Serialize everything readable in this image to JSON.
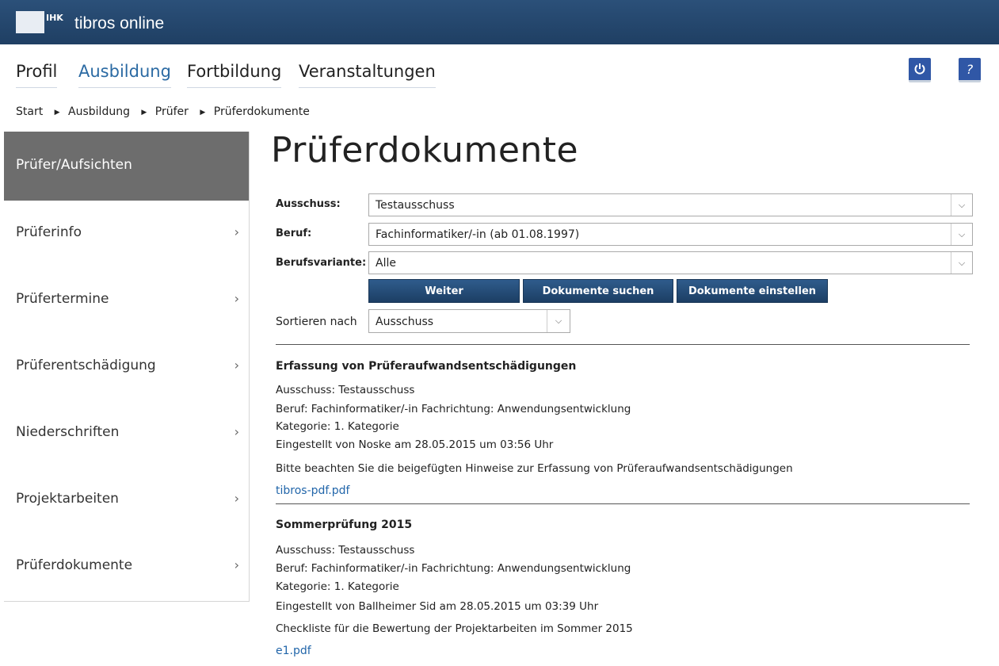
{
  "header": {
    "logo_text": "IHK",
    "app_title": "tibros online"
  },
  "mainnav": {
    "items": [
      {
        "label": "Profil"
      },
      {
        "label": "Ausbildung",
        "active": true
      },
      {
        "label": "Fortbildung"
      },
      {
        "label": "Veranstaltungen"
      }
    ],
    "logout_icon": "power-icon",
    "help_label": "?"
  },
  "breadcrumb": [
    "Start",
    "Ausbildung",
    "Prüfer",
    "Prüferdokumente"
  ],
  "sidebar": {
    "heading": "Prüfer/Aufsichten",
    "items": [
      {
        "label": "Prüferinfo"
      },
      {
        "label": "Prüfertermine"
      },
      {
        "label": "Prüferentschädigung"
      },
      {
        "label": "Niederschriften"
      },
      {
        "label": "Projektarbeiten"
      },
      {
        "label": "Prüferdokumente"
      }
    ],
    "chevron": "›"
  },
  "page_title": "Prüferdokumente",
  "form": {
    "ausschuss": {
      "label": "Ausschuss:",
      "value": "Testausschuss"
    },
    "beruf": {
      "label": "Beruf:",
      "value": "Fachinformatiker/-in (ab 01.08.1997)"
    },
    "berufsvariante": {
      "label": "Berufsvariante:",
      "value": "Alle"
    },
    "buttons": {
      "weiter": "Weiter",
      "suchen": "Dokumente suchen",
      "einstellen": "Dokumente einstellen"
    },
    "sort": {
      "label": "Sortieren nach",
      "value": "Ausschuss"
    }
  },
  "documents": [
    {
      "title": "Erfassung von Prüferaufwandsentschädigungen",
      "ausschuss": "Ausschuss: Testausschuss",
      "beruf": "Beruf: Fachinformatiker/-in Fachrichtung: Anwendungsentwicklung",
      "kategorie": "Kategorie: 1. Kategorie",
      "eingestellt": "Eingestellt von Noske am 28.05.2015 um 03:56 Uhr",
      "beschreibung": "Bitte beachten Sie die beigefügten Hinweise zur Erfassung von Prüferaufwandsentschädigungen",
      "file": "tibros-pdf.pdf"
    },
    {
      "title": "Sommerprüfung 2015",
      "ausschuss": "Ausschuss: Testausschuss",
      "beruf": "Beruf: Fachinformatiker/-in Fachrichtung: Anwendungsentwicklung",
      "kategorie": "Kategorie: 1. Kategorie",
      "eingestellt": "Eingestellt von Ballheimer Sid am 28.05.2015 um 03:39 Uhr",
      "beschreibung": "Checkliste für die Bewertung der Projektarbeiten im Sommer 2015",
      "file": "e1.pdf"
    }
  ]
}
